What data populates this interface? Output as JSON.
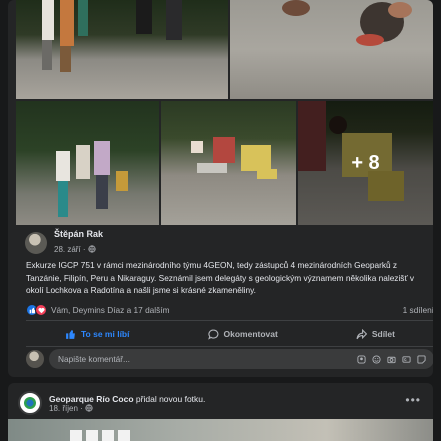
{
  "post": {
    "author": "Štěpán Rak",
    "date": "28. září",
    "audience_icon": "globe-icon",
    "text": "Exkurze IGCP 751 v rámci mezinárodního týmu 4GEON, tedy zástupců 4 mezinárodních Geoparků z Tanzánie, Filipín, Peru a Nikaraguy. Seznámil jsem delegáty s geologickým významem několika nalezišť v okolí Lochkova a Radotína a našli jsme si krásné zkameněliny.",
    "more_photos": "+ 8",
    "reactions_text": "Vám, Deymins Díaz a 17 dalším",
    "shares": "1 sdílení",
    "actions": {
      "like": "To se mi líbí",
      "comment": "Okomentovat",
      "share": "Sdílet"
    },
    "comment_placeholder": "Napište komentář..."
  },
  "next_post": {
    "page": "Geoparque Río Coco",
    "action": "přidal novou fotku.",
    "date": "18. říjen",
    "more": "•••"
  },
  "colors": {
    "card_bg": "#242526",
    "page_bg": "#18191a",
    "accent": "#2d88ff",
    "like": "#1b74e4",
    "love": "#f33e58"
  }
}
